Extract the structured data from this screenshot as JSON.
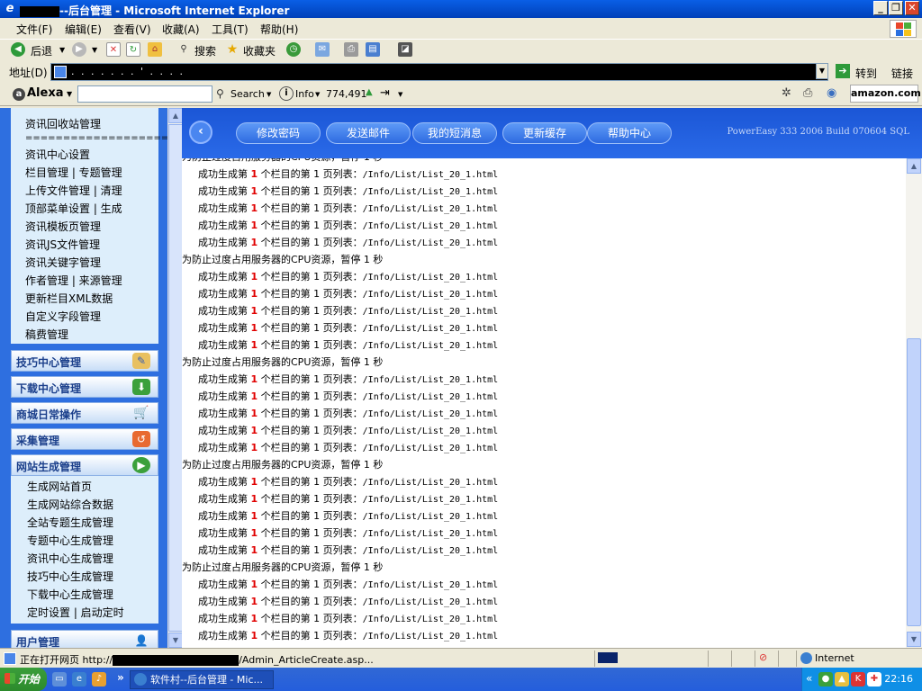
{
  "window": {
    "title": "--后台管理 - Microsoft Internet Explorer",
    "controls": [
      "_",
      "❐",
      "✕"
    ]
  },
  "menubar": {
    "items": [
      "文件(F)",
      "编辑(E)",
      "查看(V)",
      "收藏(A)",
      "工具(T)",
      "帮助(H)"
    ]
  },
  "toolbar": {
    "back": "后退",
    "search": "搜索",
    "favorites": "收藏夹"
  },
  "addressbar": {
    "label": "地址(D)",
    "url": ".  .  .  .  .  .  .  '  .  .  .  .",
    "go": "转到",
    "links": "链接"
  },
  "alexabar": {
    "logo": "Alexa",
    "search_label": "Search",
    "info_label": "Info",
    "rank": "774,491",
    "amazon": "amazon.com"
  },
  "sidebar": {
    "items_top": [
      "资讯回收站管理",
      "====================",
      "资讯中心设置",
      "栏目管理 | 专题管理",
      "上传文件管理 | 清理",
      "顶部菜单设置 | 生成",
      "资讯模板页管理",
      "资讯JS文件管理",
      "资讯关键字管理",
      "作者管理 | 来源管理",
      "更新栏目XML数据",
      "自定义字段管理",
      "稿费管理"
    ],
    "categories": [
      "技巧中心管理",
      "下载中心管理",
      "商城日常操作",
      "采集管理",
      "网站生成管理"
    ],
    "items_bottom": [
      "生成网站首页",
      "生成网站综合数据",
      "全站专题生成管理",
      "专题中心生成管理",
      "资讯中心生成管理",
      "技巧中心生成管理",
      "下载中心生成管理",
      "定时设置 | 启动定时"
    ],
    "last_category": "用户管理"
  },
  "banner": {
    "buttons": [
      "修改密码",
      "发送邮件",
      "我的短消息",
      "更新缓存",
      "帮助中心"
    ],
    "version": "PowerEasy 333 2006 Build 070604 SQL"
  },
  "content": {
    "success_prefix": "成功生成第",
    "success_num": "1",
    "success_mid": "个栏目的第 1 页列表：",
    "success_path": "/Info/List/List_20_1.html",
    "pause": "为防止过度占用服务器的CPU资源，暂停 1 秒",
    "top_partial": "为防止过度占用服务器的CPU资源，暂停 1 秒"
  },
  "statusbar": {
    "text": "正在打开网页 http://",
    "text_suffix": "/Admin_ArticleCreate.asp...",
    "zone": "Internet"
  },
  "taskbar": {
    "start": "开始",
    "task": "软件村--后台管理 - Mic...",
    "clock": "22:16",
    "chevron": "»"
  }
}
